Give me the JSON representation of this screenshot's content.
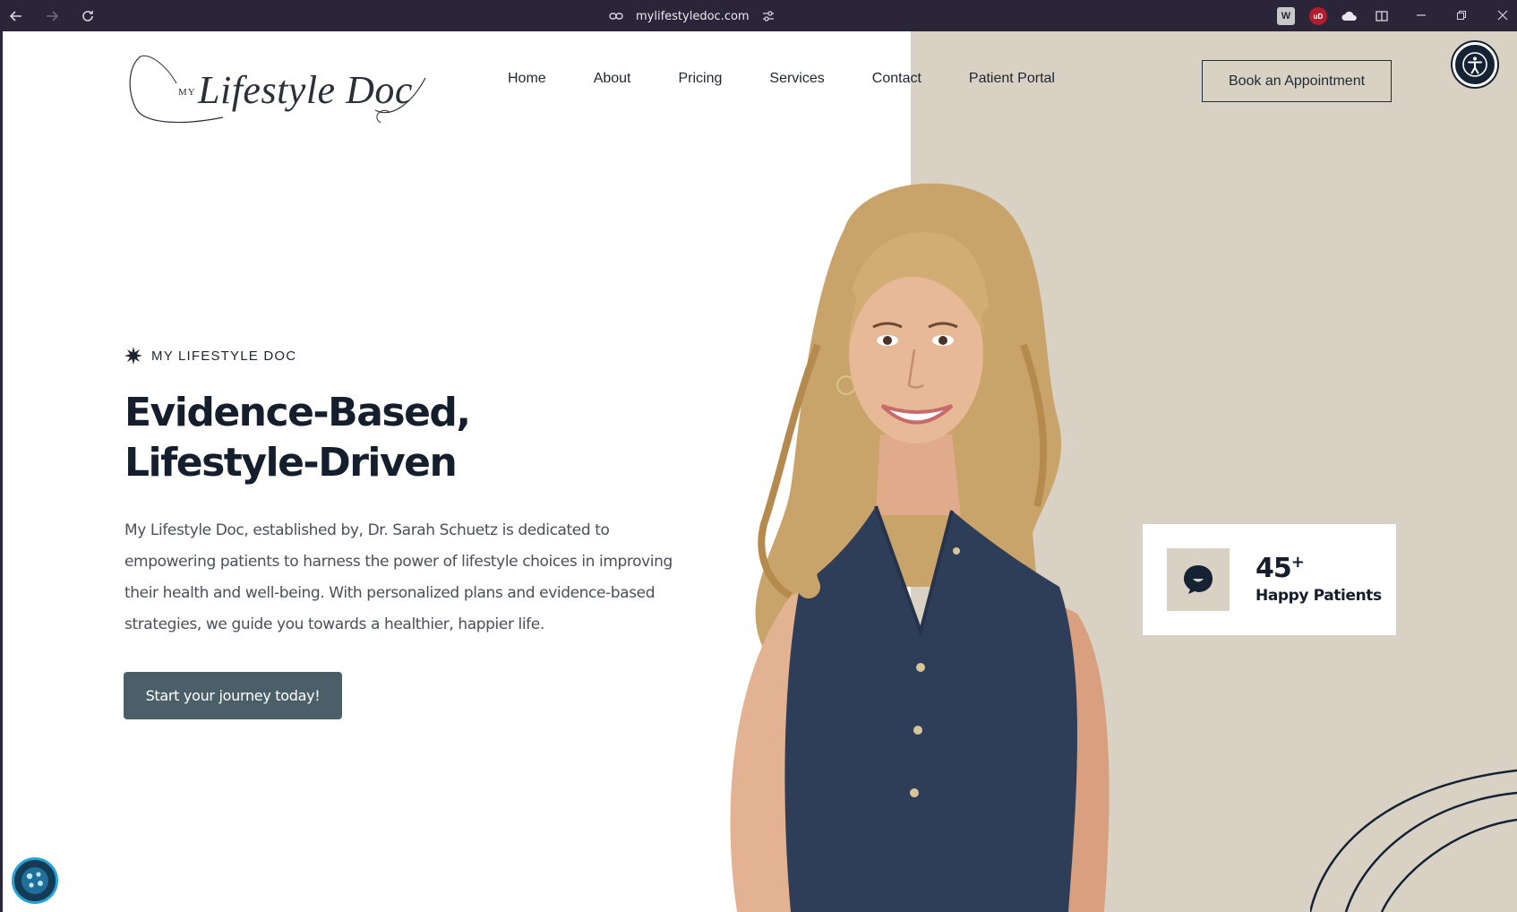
{
  "browser": {
    "url": "mylifestyledoc.com",
    "back_icon": "arrow-left-icon",
    "forward_icon": "arrow-right-icon",
    "reload_icon": "reload-icon",
    "extensions": [
      {
        "name": "w-extension-icon",
        "label": "W"
      },
      {
        "name": "ublock-icon",
        "label": "uD"
      },
      {
        "name": "cloud-extension-icon",
        "label": ""
      },
      {
        "name": "sidebar-toggle-icon",
        "label": ""
      }
    ]
  },
  "header": {
    "logo_small": "MY",
    "logo_main": "Lifestyle Doc",
    "nav": [
      "Home",
      "About",
      "Pricing",
      "Services",
      "Contact",
      "Patient Portal"
    ],
    "book_button": "Book an Appointment"
  },
  "hero": {
    "eyebrow": "MY LIFESTYLE DOC",
    "headline_line1": "Evidence-Based,",
    "headline_line2": "Lifestyle-Driven",
    "paragraph": "My Lifestyle Doc, established by, Dr. Sarah Schuetz is dedicated to empowering patients to harness the power of lifestyle choices in improving their health and well-being. With personalized plans and evidence-based strategies, we guide you towards a healthier, happier life.",
    "cta": "Start your journey today!"
  },
  "stat": {
    "number": "45",
    "suffix": "+",
    "label": "Happy Patients",
    "icon": "chat-bubble-smile-icon"
  },
  "colors": {
    "navy": "#141e2c",
    "beige": "#d9d2c4",
    "cta": "#4b5f68",
    "dress": "#2f3e58",
    "hair": "#c9a46a"
  }
}
